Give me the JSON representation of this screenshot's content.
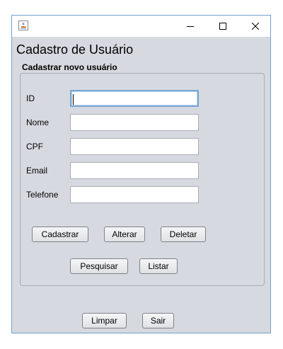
{
  "window": {
    "controls": {
      "minimize": "—",
      "maximize": "☐",
      "close": "✕"
    }
  },
  "heading": "Cadastro de Usuário",
  "group": {
    "title": "Cadastrar novo usuário"
  },
  "fields": {
    "id": {
      "label": "ID",
      "value": ""
    },
    "nome": {
      "label": "Nome",
      "value": ""
    },
    "cpf": {
      "label": "CPF",
      "value": ""
    },
    "email": {
      "label": "Email",
      "value": ""
    },
    "telefone": {
      "label": "Telefone",
      "value": ""
    }
  },
  "buttons": {
    "cadastrar": "Cadastrar",
    "alterar": "Alterar",
    "deletar": "Deletar",
    "pesquisar": "Pesquisar",
    "listar": "Listar",
    "limpar": "Limpar",
    "sair": "Sair"
  },
  "icons": {
    "app": "java-cup-icon",
    "minimize": "minimize-icon",
    "maximize": "maximize-icon",
    "close": "close-icon"
  },
  "colors": {
    "window_bg": "#d6d9df",
    "titlebar_bg": "#ffffff",
    "window_border": "#6f9fd0",
    "focus_border": "#7aa7d6"
  }
}
